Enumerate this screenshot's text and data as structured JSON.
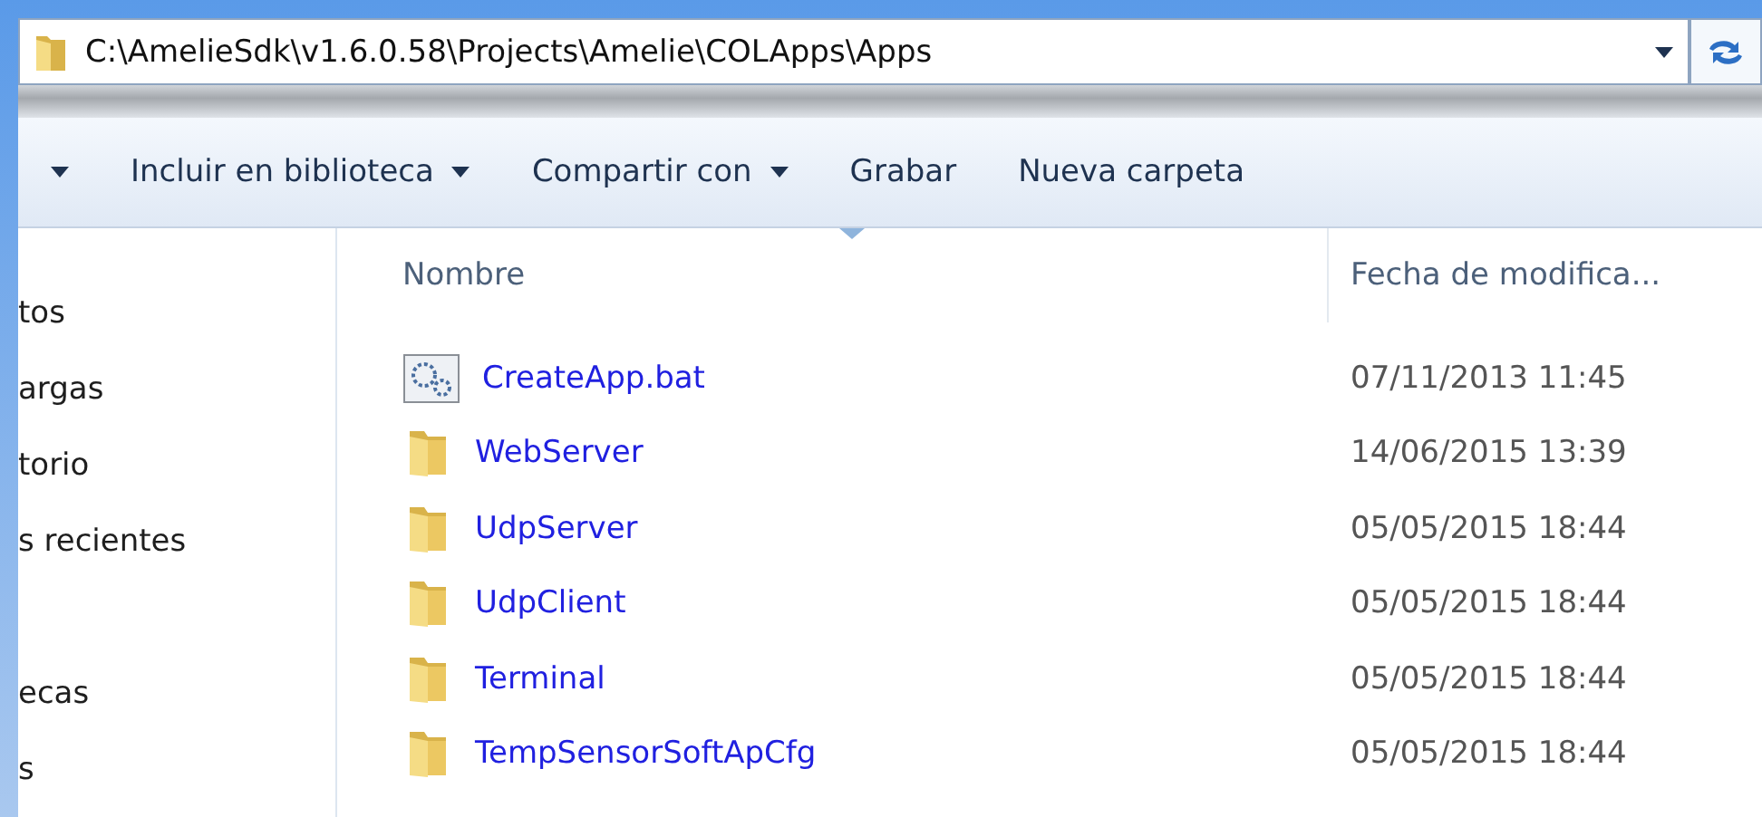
{
  "address_bar": {
    "path": "C:\\AmelieSdk\\v1.6.0.58\\Projects\\Amelie\\COLApps\\Apps"
  },
  "toolbar": [
    {
      "dropdown": true
    },
    {
      "label": "Incluir en biblioteca",
      "dropdown": true
    },
    {
      "label": "Compartir con",
      "dropdown": true
    },
    {
      "label": "Grabar",
      "dropdown": false
    },
    {
      "label": "Nueva carpeta",
      "dropdown": false
    }
  ],
  "sidebar": {
    "groups": [
      [
        "tos",
        "argas",
        "torio",
        "s recientes"
      ],
      [
        "ecas",
        "s"
      ]
    ]
  },
  "table": {
    "columns": [
      {
        "label": "Nombre",
        "sorted": true
      },
      {
        "label": "Fecha de modifica..."
      }
    ],
    "rows": [
      {
        "kind": "bat",
        "name": "CreateApp.bat",
        "date": "07/11/2013 11:45"
      },
      {
        "kind": "folder",
        "name": "WebServer",
        "date": "14/06/2015 13:39"
      },
      {
        "kind": "folder",
        "name": "UdpServer",
        "date": "05/05/2015 18:44"
      },
      {
        "kind": "folder",
        "name": "UdpClient",
        "date": "05/05/2015 18:44"
      },
      {
        "kind": "folder",
        "name": "Terminal",
        "date": "05/05/2015 18:44"
      },
      {
        "kind": "folder",
        "name": "TempSensorSoftApCfg",
        "date": "05/05/2015 18:44"
      }
    ]
  }
}
